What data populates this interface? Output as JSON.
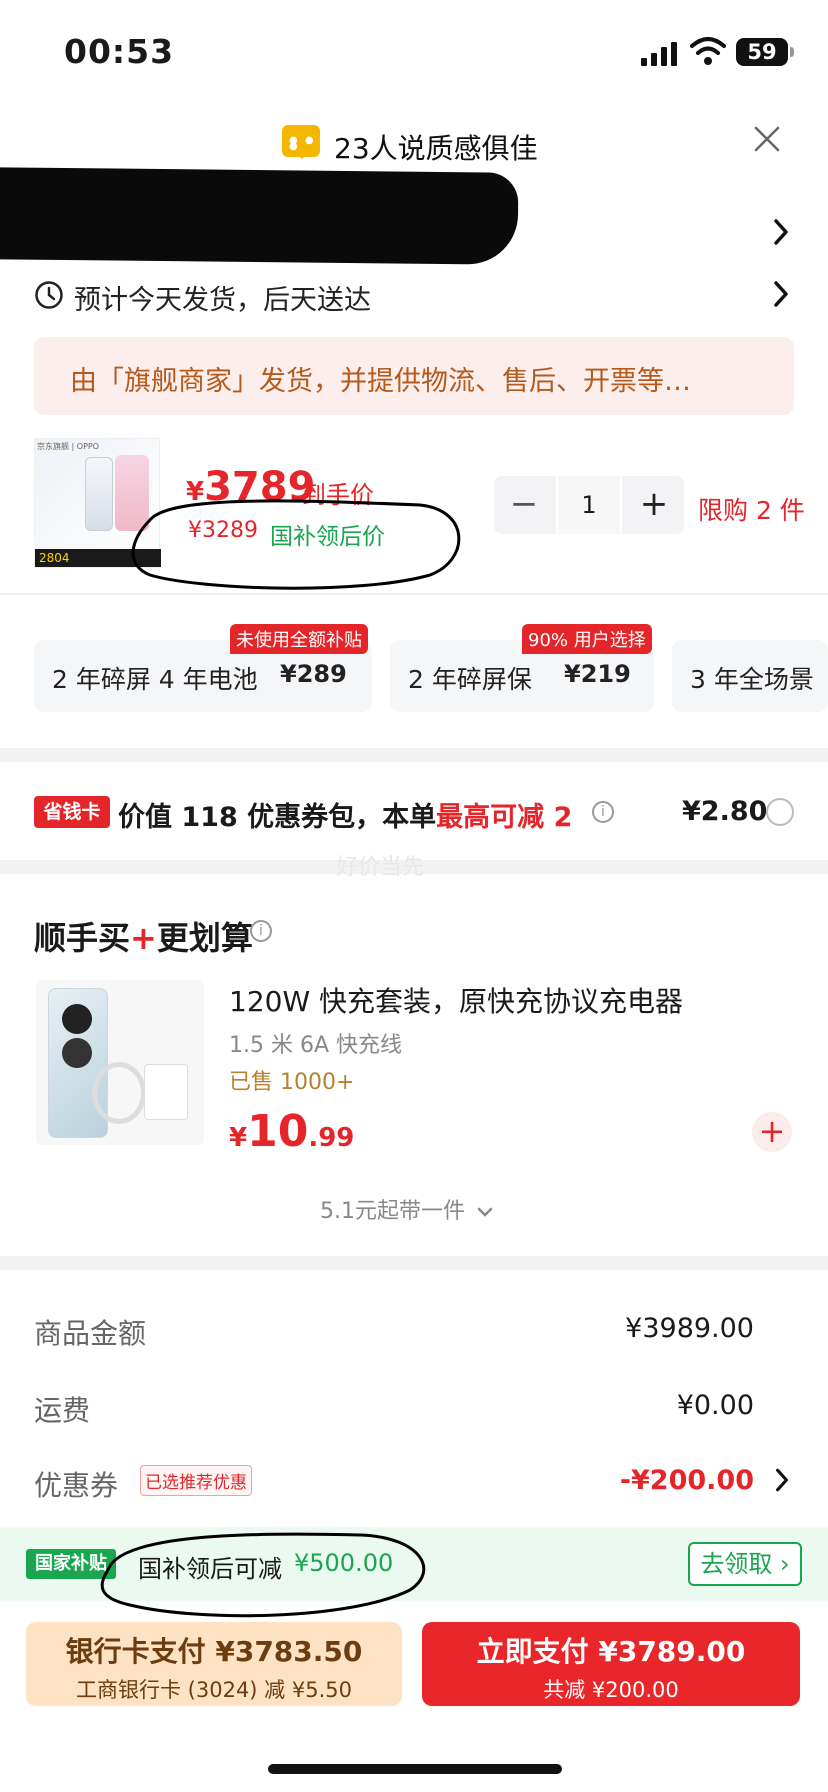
{
  "status": {
    "time": "00:53",
    "battery": "59"
  },
  "header": {
    "title": "23人说质感俱佳"
  },
  "delivery": {
    "text": "预计今天发货，后天送达"
  },
  "seller_notice": "由「旗舰商家」发货，并提供物流、售后、开票等…",
  "product": {
    "image_brand": "京东旗舰 | OPPO",
    "image_tag": "2804",
    "price_symbol": "¥",
    "price": "3789",
    "price_label": "到手价",
    "sub_price": "¥3289",
    "sub_price_label": "国补领后价",
    "quantity": "1",
    "limit": "限购 2 件"
  },
  "services": [
    {
      "name": "2 年碎屏 4 年电池",
      "price": "¥289",
      "badge": "未使用全额补贴"
    },
    {
      "name": "2 年碎屏保",
      "price": "¥219",
      "badge": "90% 用户选择"
    },
    {
      "name": "3 年全场景",
      "price": "",
      "badge": ""
    }
  ],
  "savings_card": {
    "badge": "省钱卡",
    "text": "价值 118 优惠券包，本单",
    "highlight": "最高可减 2",
    "price": "¥2.80"
  },
  "watermark": "好价当先",
  "addon": {
    "section_title_a": "顺手买",
    "section_title_b": "更划算",
    "name": "120W 快充套装，原快充协议充电器",
    "sub": "1.5 米 6A 快充线",
    "sold": "已售 1000+",
    "price_symbol": "¥",
    "price_int": "10",
    "price_dec": ".99",
    "more": "5.1元起带一件"
  },
  "summary": {
    "goods_label": "商品金额",
    "goods_value": "¥3989.00",
    "shipping_label": "运费",
    "shipping_value": "¥0.00",
    "coupon_label": "优惠券",
    "coupon_badge": "已选推荐优惠",
    "coupon_value": "-¥200.00"
  },
  "gov_subsidy": {
    "badge": "国家补贴",
    "text": "国补领后可减",
    "value": "¥500.00",
    "button": "去领取"
  },
  "pay": {
    "bank_title": "银行卡支付 ¥3783.50",
    "bank_sub": "工商银行卡 (3024) 减 ¥5.50",
    "now_title": "立即支付 ¥3789.00",
    "now_sub": "共减 ¥200.00"
  },
  "colors": {
    "accent_red": "#e4262a",
    "green": "#1aa64f",
    "notice_bg": "#fdeeee"
  }
}
